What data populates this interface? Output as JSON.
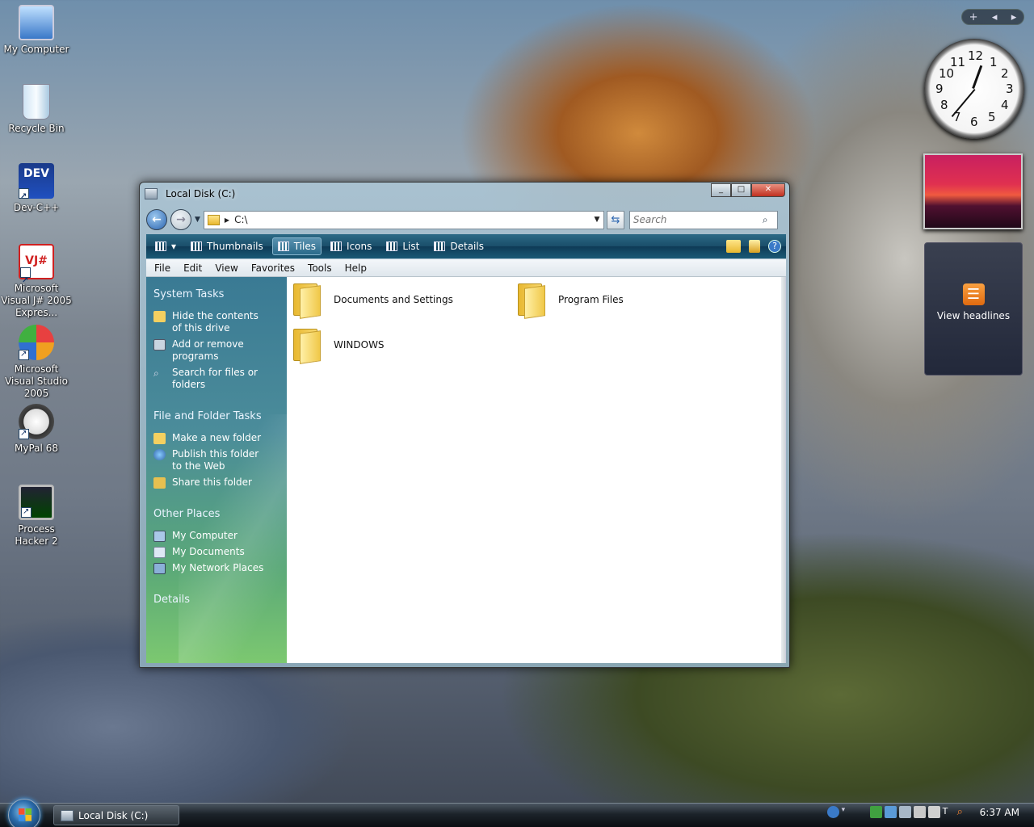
{
  "desktop": {
    "icons": [
      {
        "label": "My Computer",
        "icon": "computer-icon"
      },
      {
        "label": "Recycle Bin",
        "icon": "recycle-bin-icon"
      },
      {
        "label": "Dev-C++",
        "icon": "dev-cpp-icon"
      },
      {
        "label": "Microsoft Visual J# 2005 Expres...",
        "icon": "vjsharp-icon"
      },
      {
        "label": "Microsoft Visual Studio 2005",
        "icon": "visual-studio-icon"
      },
      {
        "label": "MyPal 68",
        "icon": "mypal-icon"
      },
      {
        "label": "Process Hacker 2",
        "icon": "process-hacker-icon"
      }
    ]
  },
  "gadgets": {
    "clock_numbers": [
      "12",
      "1",
      "2",
      "3",
      "4",
      "5",
      "6",
      "7",
      "8",
      "9",
      "10",
      "11"
    ],
    "feed_label": "View headlines",
    "bar_add": "+",
    "bar_prev": "◂",
    "bar_next": "▸"
  },
  "window": {
    "title": "Local Disk (C:)",
    "address": "C:\\",
    "search_placeholder": "Search",
    "toolbar": {
      "views": [
        "Thumbnails",
        "Tiles",
        "Icons",
        "List",
        "Details"
      ],
      "active_view": "Tiles"
    },
    "menu": [
      "File",
      "Edit",
      "View",
      "Favorites",
      "Tools",
      "Help"
    ],
    "taskpane": {
      "system_tasks": {
        "heading": "System Tasks",
        "items": [
          "Hide the contents of this drive",
          "Add or remove programs",
          "Search for files or folders"
        ]
      },
      "file_folder_tasks": {
        "heading": "File and Folder Tasks",
        "items": [
          "Make a new folder",
          "Publish this folder to the Web",
          "Share this folder"
        ]
      },
      "other_places": {
        "heading": "Other Places",
        "items": [
          "My Computer",
          "My Documents",
          "My Network Places"
        ]
      },
      "details_heading": "Details"
    },
    "folders": [
      "Documents and Settings",
      "Program Files",
      "WINDOWS"
    ]
  },
  "taskbar": {
    "task_label": "Local Disk (C:)",
    "clock": "6:37 AM"
  },
  "colors": {
    "taskpane_top": "#3a7a94",
    "taskpane_bottom": "#7cc870",
    "command_bar": "#1a4e6a",
    "folder_yellow": "#f0c848"
  }
}
